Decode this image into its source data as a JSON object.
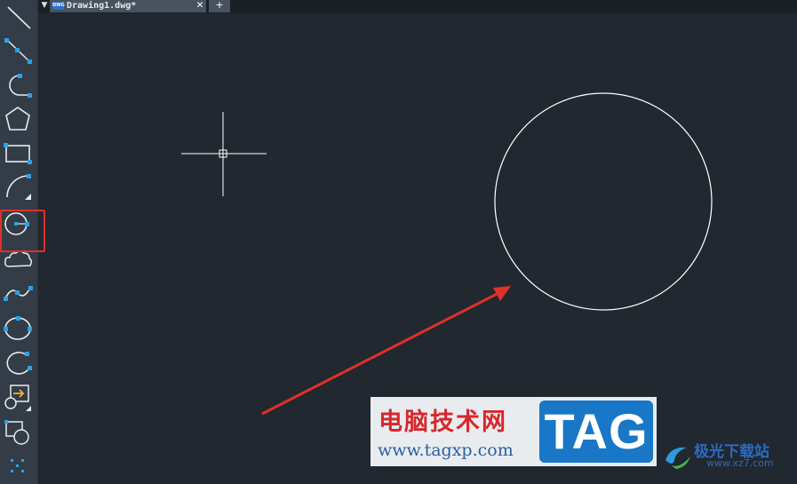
{
  "document_tab": {
    "dwg_badge": "DWG",
    "title": "Drawing1.dwg*",
    "close_glyph": "✕",
    "menu_glyph": "▼",
    "new_tab_glyph": "+"
  },
  "toolbar": {
    "tools": [
      {
        "icon": "line-icon"
      },
      {
        "icon": "construction-line-icon"
      },
      {
        "icon": "polyline-arc-icon"
      },
      {
        "icon": "polygon-icon"
      },
      {
        "icon": "rectangle-icon"
      },
      {
        "icon": "arc-icon"
      },
      {
        "icon": "circle-center-radius-icon",
        "highlighted": true
      },
      {
        "icon": "revision-cloud-icon"
      },
      {
        "icon": "spline-icon"
      },
      {
        "icon": "ellipse-icon"
      },
      {
        "icon": "ellipse-arc-icon"
      },
      {
        "icon": "insert-block-icon"
      },
      {
        "icon": "make-block-icon"
      },
      {
        "icon": "point-icon"
      }
    ]
  },
  "colors": {
    "canvas_bg": "#212830",
    "toolbar_bg": "#333c47",
    "icon_stroke": "#e8ecef",
    "grip": "#29a3e8",
    "highlight_box": "#e0302a",
    "arrow": "#e0302a",
    "drawn_geometry": "#ffffff"
  },
  "watermark": {
    "title": "电脑技术网",
    "url": "www.tagxp.com",
    "logo": "TAG"
  },
  "corner_logo": {
    "name": "极光下载站",
    "url": "www.xz7.com"
  }
}
